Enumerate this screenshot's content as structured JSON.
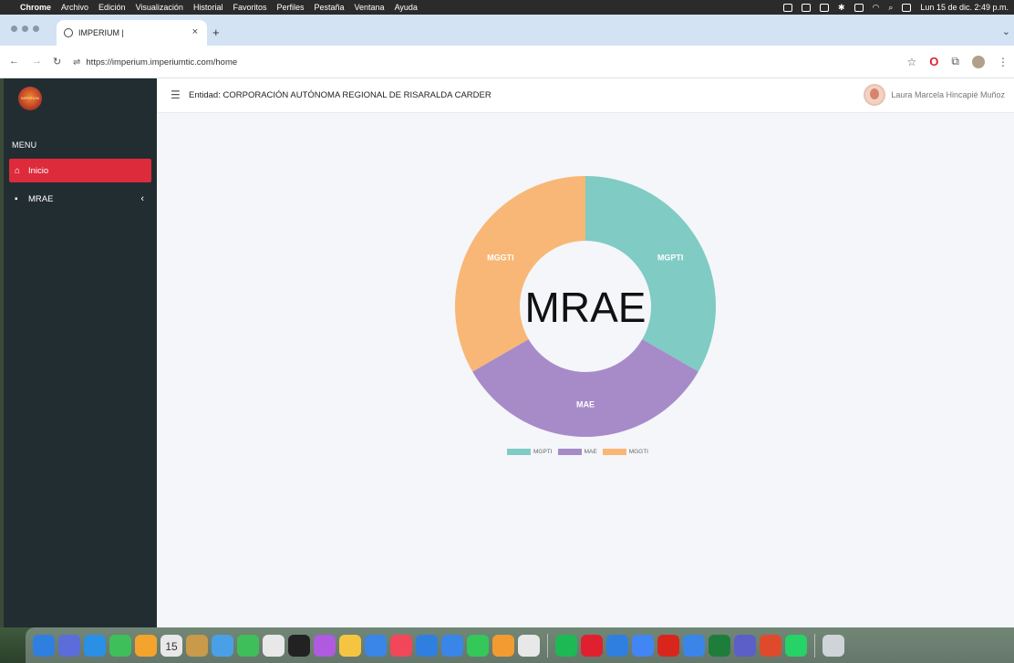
{
  "menubar": {
    "items": [
      "Chrome",
      "Archivo",
      "Edición",
      "Visualización",
      "Historial",
      "Favoritos",
      "Perfiles",
      "Pestaña",
      "Ventana",
      "Ayuda"
    ],
    "clock": "Lun 15 de dic. 2:49 p.m."
  },
  "browser": {
    "tab_title": "IMPERIUM |",
    "new_tab": "+",
    "url": "https://imperium.imperiumtic.com/home"
  },
  "app": {
    "logo_text": "IMPERIUM",
    "entity": "Entidad: CORPORACIÓN AUTÓNOMA REGIONAL DE RISARALDA CARDER",
    "user_name": "Laura Marcela Hincapié Muñoz",
    "menu_header": "MENU",
    "sidebar": [
      {
        "label": "Inicio",
        "icon": "home-icon",
        "active": true
      },
      {
        "label": "MRAE",
        "icon": "file-icon",
        "active": false,
        "has_submenu": true
      }
    ]
  },
  "colors": {
    "sidebar_bg": "#222d32",
    "active_red": "#dd2b3b",
    "teal": "#80cbc4",
    "purple": "#a78bc9",
    "orange": "#f8b776"
  },
  "chart_data": {
    "type": "pie",
    "center_label": "MRAE",
    "categories": [
      "MGPTI",
      "MAE",
      "MGGTI"
    ],
    "values": [
      1,
      1,
      1
    ],
    "colors": [
      "#80cbc4",
      "#a78bc9",
      "#f8b776"
    ],
    "legend": "bottom"
  },
  "dock": {
    "calendar_day": "15"
  }
}
